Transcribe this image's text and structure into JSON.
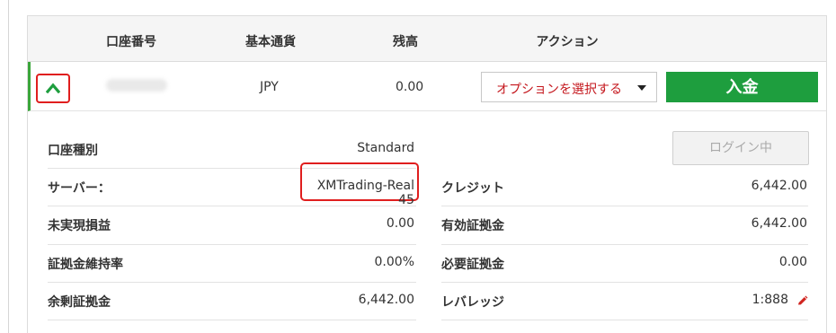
{
  "table": {
    "headers": {
      "account_number": "口座番号",
      "base_currency": "基本通貨",
      "balance": "残高",
      "action": "アクション"
    },
    "row": {
      "account_number": "",
      "currency": "JPY",
      "balance": "0.00",
      "options_label": "オプションを選択する",
      "deposit_label": "入金"
    }
  },
  "details": {
    "account_type_label": "口座種別",
    "account_type_value": "Standard",
    "login_button_label": "ログイン中",
    "server_label": "サーバー：",
    "server_value": "XMTrading-Real 45",
    "credit_label": "クレジット",
    "credit_value": "6,442.00",
    "unrealized_pl_label": "未実現損益",
    "unrealized_pl_value": "0.00",
    "equity_label": "有効証拠金",
    "equity_value": "6,442.00",
    "margin_level_label": "証拠金維持率",
    "margin_level_value": "0.00%",
    "required_margin_label": "必要証拠金",
    "required_margin_value": "0.00",
    "free_margin_label": "余剰証拠金",
    "free_margin_value": "6,442.00",
    "leverage_label": "レバレッジ",
    "leverage_value": "1:888"
  },
  "colors": {
    "accent_green": "#1e9e3e",
    "row_marker_green": "#3aa63a",
    "highlight_red": "#e01e1e",
    "option_text_red": "#c4161c"
  },
  "icons": [
    "chevron-up-icon",
    "caret-down-icon",
    "pencil-icon"
  ]
}
